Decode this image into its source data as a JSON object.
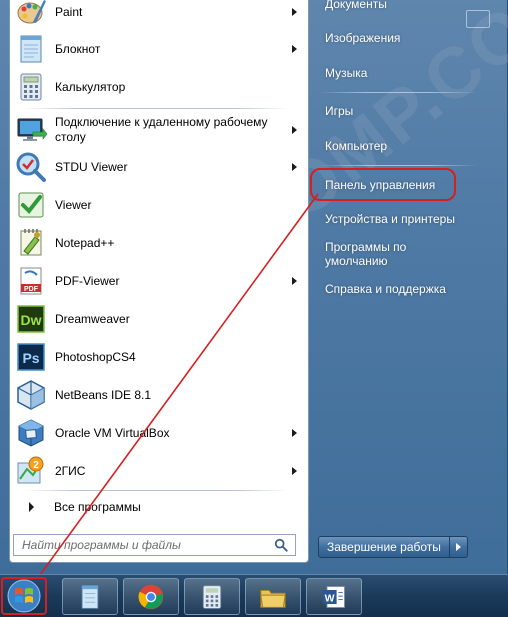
{
  "programs": [
    {
      "label": "Paint",
      "icon": "paint-icon",
      "has_submenu": true
    },
    {
      "label": "Блокнот",
      "icon": "notepad-icon",
      "has_submenu": true
    },
    {
      "label": "Калькулятор",
      "icon": "calculator-icon",
      "has_submenu": false
    },
    {
      "label": "Подключение к удаленному рабочему столу",
      "icon": "remote-desktop-icon",
      "has_submenu": true
    },
    {
      "label": "STDU Viewer",
      "icon": "stdu-viewer-icon",
      "has_submenu": true
    },
    {
      "label": "Viewer",
      "icon": "viewer-icon",
      "has_submenu": false
    },
    {
      "label": "Notepad++",
      "icon": "notepad-plus-plus-icon",
      "has_submenu": false
    },
    {
      "label": "PDF-Viewer",
      "icon": "pdf-viewer-icon",
      "has_submenu": true
    },
    {
      "label": "Dreamweaver",
      "icon": "dreamweaver-icon",
      "has_submenu": false
    },
    {
      "label": "PhotoshopCS4",
      "icon": "photoshop-icon",
      "has_submenu": false
    },
    {
      "label": "NetBeans IDE 8.1",
      "icon": "netbeans-icon",
      "has_submenu": false
    },
    {
      "label": "Oracle VM VirtualBox",
      "icon": "virtualbox-icon",
      "has_submenu": true
    },
    {
      "label": "2ГИС",
      "icon": "2gis-icon",
      "has_submenu": true
    }
  ],
  "icon_text": {
    "dreamweaver": "Dw",
    "photoshop": "Ps",
    "pdf": "PDF",
    "gis": "2"
  },
  "all_programs_label": "Все программы",
  "search_placeholder": "Найти программы и файлы",
  "right_panel": {
    "items": [
      {
        "label": "Документы"
      },
      {
        "label": "Изображения"
      },
      {
        "label": "Музыка"
      },
      {
        "label": "Игры"
      },
      {
        "label": "Компьютер"
      },
      {
        "label": "Панель управления"
      },
      {
        "label": "Устройства и принтеры"
      },
      {
        "label": "Программы по умолчанию"
      },
      {
        "label": "Справка и поддержка"
      }
    ]
  },
  "shutdown_label": "Завершение работы",
  "watermark": "CHAYCOMP.COM",
  "taskbar": {
    "pinned_icons": [
      "notepad-icon",
      "chrome-icon",
      "calculator-icon",
      "file-explorer-icon",
      "word-icon"
    ],
    "word_glyph": "W"
  },
  "colors": {
    "highlight": "#d61f1f",
    "menu_blue": "#4f7aa5",
    "taskbar": "#1b3a5a"
  }
}
